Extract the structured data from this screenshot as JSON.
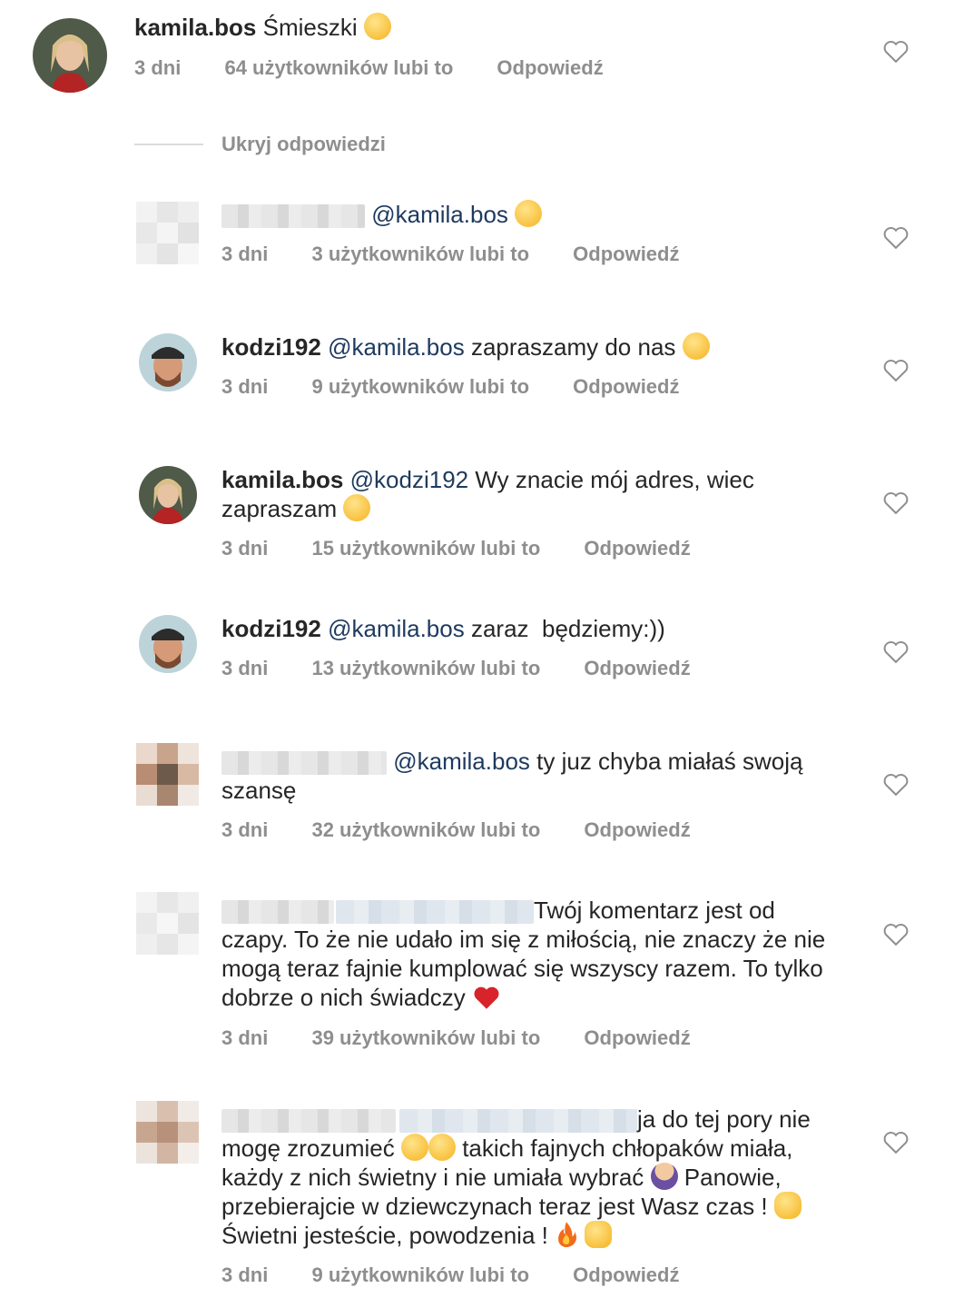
{
  "top_comment": {
    "username": "kamila.bos",
    "text": "Śmieszki",
    "emoji": "laughing-tears-emoji",
    "time": "3 dni",
    "likes": "64 użytkowników lubi to",
    "reply": "Odpowiedź"
  },
  "hide_replies": "Ukryj odpowiedzi",
  "replies": [
    {
      "username": "",
      "mention": "@kamila.bos",
      "text": "",
      "emoji": "zipper-mouth-emoji",
      "time": "3 dni",
      "likes": "3 użytkowników lubi to",
      "reply": "Odpowiedź"
    },
    {
      "username": "kodzi192",
      "mention": "@kamila.bos",
      "text": "zapraszamy do nas",
      "emoji": "kissing-emoji",
      "time": "3 dni",
      "likes": "9 użytkowników lubi to",
      "reply": "Odpowiedź"
    },
    {
      "username": "kamila.bos",
      "mention": "@kodzi192",
      "text": "Wy znacie mój adres, wiec",
      "text2": "zapraszam",
      "emoji": "smiling-emoji",
      "time": "3 dni",
      "likes": "15 użytkowników lubi to",
      "reply": "Odpowiedź"
    },
    {
      "username": "kodzi192",
      "mention": "@kamila.bos",
      "text": "zaraz  będziemy:))",
      "time": "3 dni",
      "likes": "13 użytkowników lubi to",
      "reply": "Odpowiedź"
    },
    {
      "username": "",
      "mention": "@kamila.bos",
      "text": "ty juz chyba miałaś swoją",
      "text2": "szansę",
      "time": "3 dni",
      "likes": "32 użytkowników lubi to",
      "reply": "Odpowiedź"
    },
    {
      "username": "",
      "text": "Twój komentarz jest od",
      "text2": "czapy. To że nie udało im się z miłością, nie znaczy że nie",
      "text3": "mogą teraz fajnie kumplować się wszyscy razem. To tylko",
      "text4": "dobrze o nich świadczy",
      "emoji": "red-heart-emoji",
      "time": "3 dni",
      "likes": "39 użytkowników lubi to",
      "reply": "Odpowiedź"
    },
    {
      "username": "",
      "text": "ja do tej pory nie",
      "text2": "mogę zrozumieć",
      "text2b": "takich fajnych chłopaków miała,",
      "text3": "każdy z nich świetny i nie umiała wybrać",
      "text3b": "Panowie,",
      "text4": "przebierajcie w dziewczynach teraz jest Wasz czas !",
      "text5": "Świetni jesteście, powodzenia !",
      "time": "3 dni",
      "likes": "9 użytkowników lubi to",
      "reply": "Odpowiedź"
    }
  ],
  "colors": {
    "text": "#262626",
    "meta": "#8e8e8e",
    "mention": "#1e3a5f",
    "heart_red": "#e0245e"
  }
}
